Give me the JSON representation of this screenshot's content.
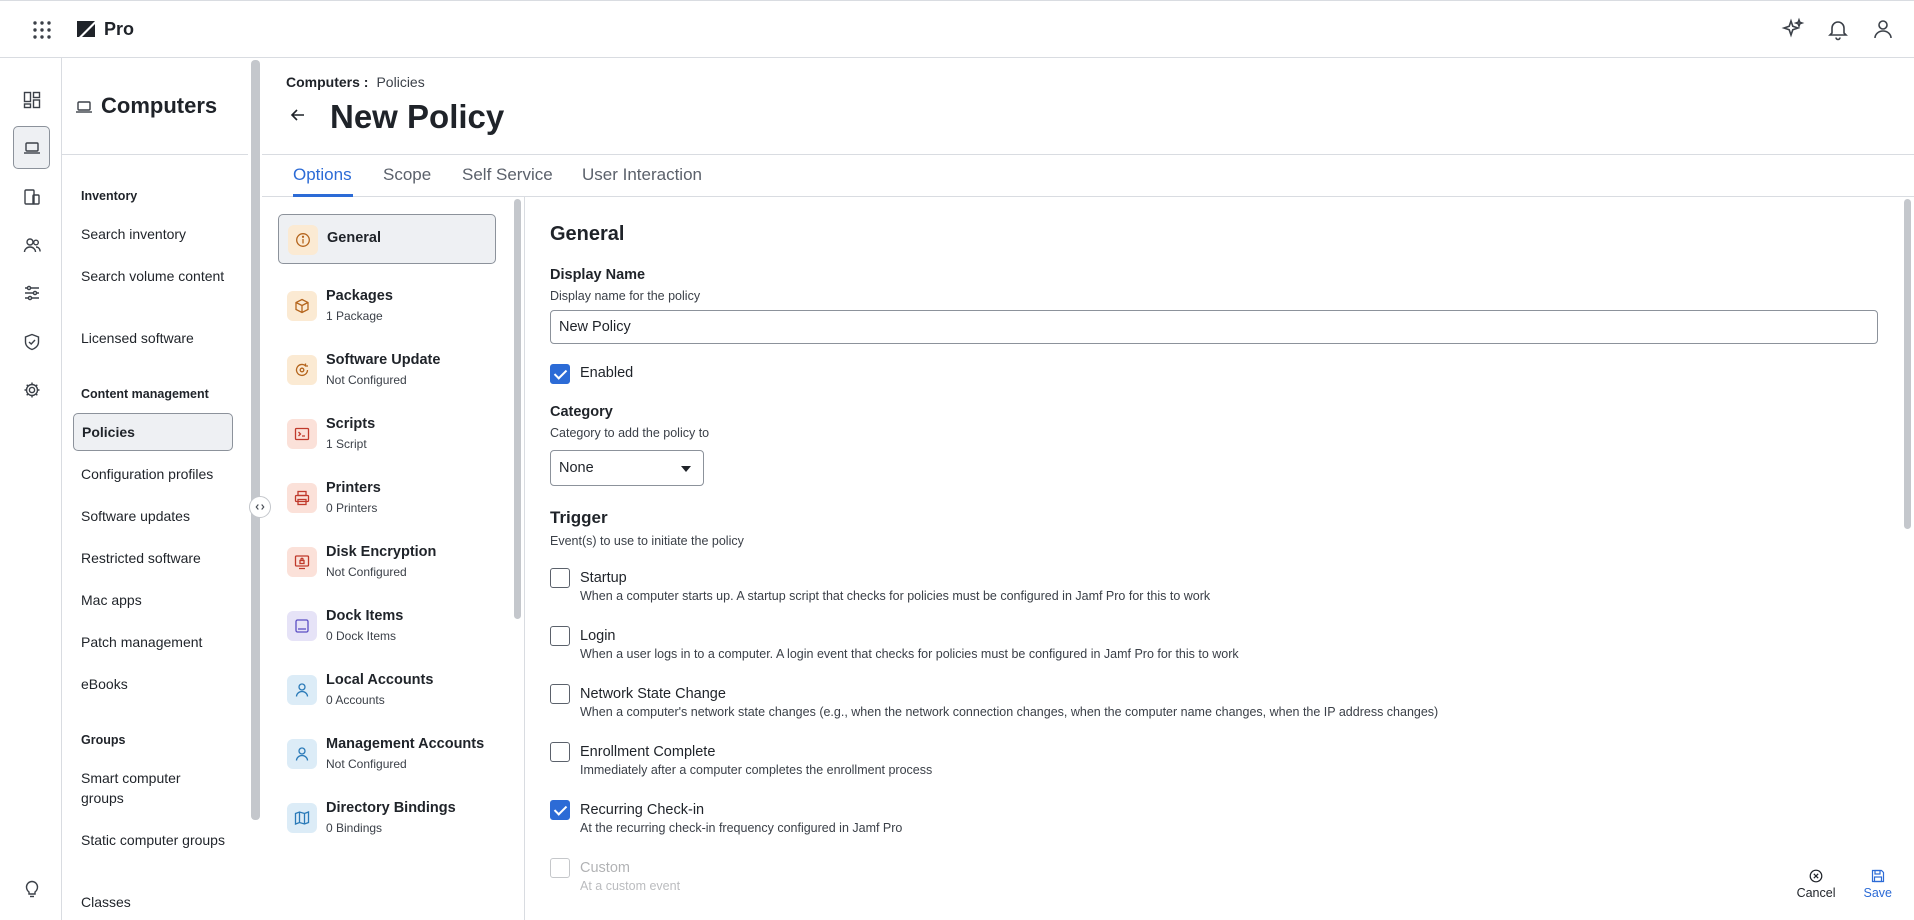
{
  "app": {
    "name": "Pro"
  },
  "section_title": "Computers",
  "sidebar": {
    "groups": [
      {
        "title": "Inventory",
        "items": [
          "Search inventory",
          "Search volume content",
          "Licensed software"
        ]
      },
      {
        "title": "Content management",
        "items": [
          "Policies",
          "Configuration profiles",
          "Software updates",
          "Restricted software",
          "Mac apps",
          "Patch management",
          "eBooks"
        ]
      },
      {
        "title": "Groups",
        "items": [
          "Smart computer groups",
          "Static computer groups",
          "Classes"
        ]
      }
    ],
    "active_item": "Policies"
  },
  "breadcrumb": {
    "root": "Computers",
    "separator": ":",
    "current": "Policies"
  },
  "page_title": "New Policy",
  "tabs": [
    "Options",
    "Scope",
    "Self Service",
    "User Interaction"
  ],
  "active_tab": "Options",
  "payloads": [
    {
      "name": "General",
      "sub": ""
    },
    {
      "name": "Packages",
      "sub": "1 Package"
    },
    {
      "name": "Software Update",
      "sub": "Not Configured"
    },
    {
      "name": "Scripts",
      "sub": "1 Script"
    },
    {
      "name": "Printers",
      "sub": "0 Printers"
    },
    {
      "name": "Disk Encryption",
      "sub": "Not Configured"
    },
    {
      "name": "Dock Items",
      "sub": "0 Dock Items"
    },
    {
      "name": "Local Accounts",
      "sub": "0 Accounts"
    },
    {
      "name": "Management Accounts",
      "sub": "Not Configured"
    },
    {
      "name": "Directory Bindings",
      "sub": "0 Bindings"
    }
  ],
  "form": {
    "heading": "General",
    "display_name": {
      "label": "Display Name",
      "help": "Display name for the policy",
      "value": "New Policy"
    },
    "enabled": {
      "label": "Enabled",
      "checked": true
    },
    "category": {
      "label": "Category",
      "help": "Category to add the policy to",
      "value": "None"
    },
    "trigger": {
      "label": "Trigger",
      "help": "Event(s) to use to initiate the policy",
      "options": [
        {
          "label": "Startup",
          "desc": "When a computer starts up. A startup script that checks for policies must be configured in Jamf Pro for this to work",
          "checked": false
        },
        {
          "label": "Login",
          "desc": "When a user logs in to a computer. A login event that checks for policies must be configured in Jamf Pro for this to work",
          "checked": false
        },
        {
          "label": "Network State Change",
          "desc": "When a computer's network state changes (e.g., when the network connection changes, when the computer name changes, when the IP address changes)",
          "checked": false
        },
        {
          "label": "Enrollment Complete",
          "desc": "Immediately after a computer completes the enrollment process",
          "checked": false
        },
        {
          "label": "Recurring Check-in",
          "desc": "At the recurring check-in frequency configured in Jamf Pro",
          "checked": true
        },
        {
          "label": "Custom",
          "desc": "At a custom event",
          "checked": false
        }
      ]
    }
  },
  "actions": {
    "cancel": "Cancel",
    "save": "Save"
  },
  "colors": {
    "accent": "#2c6bd6",
    "border": "#d9dce1"
  }
}
